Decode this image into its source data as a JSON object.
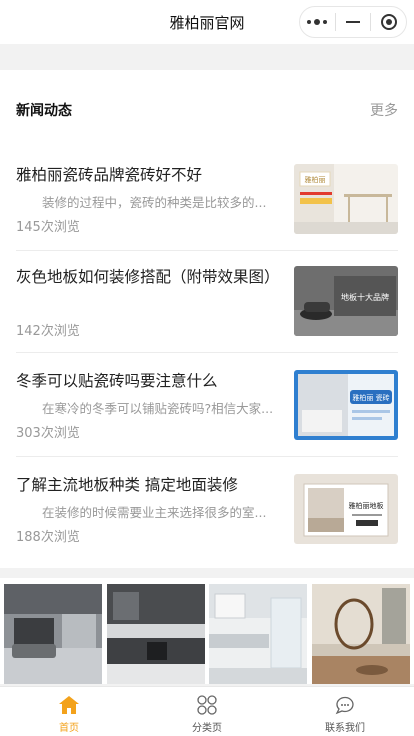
{
  "header": {
    "title": "雅柏丽官网"
  },
  "news": {
    "section_title": "新闻动态",
    "more_label": "更多",
    "items": [
      {
        "title": "雅柏丽瓷砖品牌瓷砖好不好",
        "summary": "装修的过程中，瓷砖的种类是比较多的...",
        "views": "145次浏览",
        "thumb_caption": "雅柏丽"
      },
      {
        "title": "灰色地板如何装修搭配（附带效果图）",
        "summary": "",
        "views": "142次浏览",
        "thumb_caption": "地板十大品牌"
      },
      {
        "title": "冬季可以贴瓷砖吗要注意什么",
        "summary": "在寒冷的冬季可以铺贴瓷砖吗?相信大家...",
        "views": "303次浏览",
        "thumb_caption": "雅柏丽 瓷砖"
      },
      {
        "title": "了解主流地板种类 搞定地面装修",
        "summary": "在装修的时候需要业主来选择很多的室...",
        "views": "188次浏览",
        "thumb_caption": "雅柏丽地板"
      }
    ]
  },
  "tabbar": {
    "tabs": [
      {
        "label": "首页",
        "icon": "home-icon",
        "active": true
      },
      {
        "label": "分类页",
        "icon": "grid-icon",
        "active": false
      },
      {
        "label": "联系我们",
        "icon": "chat-icon",
        "active": false
      }
    ]
  },
  "colors": {
    "accent": "#f3a21b",
    "page_bg": "#f2f2f2",
    "muted_text": "#999999"
  }
}
